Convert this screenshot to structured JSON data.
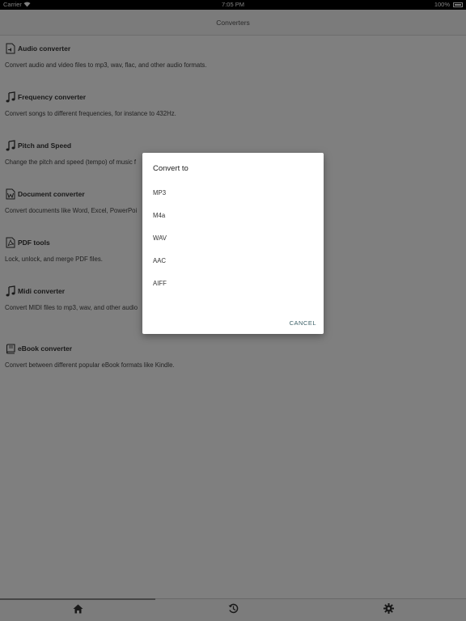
{
  "status": {
    "carrier": "Carrier",
    "time": "7:05 PM",
    "battery": "100%"
  },
  "nav": {
    "title": "Converters"
  },
  "items": [
    {
      "icon": "audio-file-icon",
      "title": "Audio converter",
      "desc": "Convert audio and video files to mp3, wav, flac, and other audio formats."
    },
    {
      "icon": "music-note-icon",
      "title": "Frequency converter",
      "desc": "Convert songs to different frequencies, for instance to 432Hz."
    },
    {
      "icon": "music-note-icon",
      "title": "Pitch and Speed",
      "desc": "Change the pitch and speed (tempo) of music f"
    },
    {
      "icon": "word-document-icon",
      "title": "Document converter",
      "desc": "Convert documents like Word, Excel, PowerPoi"
    },
    {
      "icon": "pdf-file-icon",
      "title": "PDF tools",
      "desc": "Lock, unlock, and merge PDF files."
    },
    {
      "icon": "music-note-icon",
      "title": "Midi converter",
      "desc": "Convert MIDI files to mp3, wav, and other audio"
    },
    {
      "icon": "book-icon",
      "title": "eBook converter",
      "desc": "Convert between different popular eBook formats like Kindle."
    }
  ],
  "tabs": [
    {
      "icon": "home-icon"
    },
    {
      "icon": "history-icon"
    },
    {
      "icon": "gear-icon"
    }
  ],
  "dialog": {
    "title": "Convert to",
    "options": [
      "MP3",
      "M4a",
      "WAV",
      "AAC",
      "AIFF"
    ],
    "cancel": "CANCEL"
  },
  "colors": {
    "accent": "#3b5f66",
    "overlay": "#000000"
  }
}
